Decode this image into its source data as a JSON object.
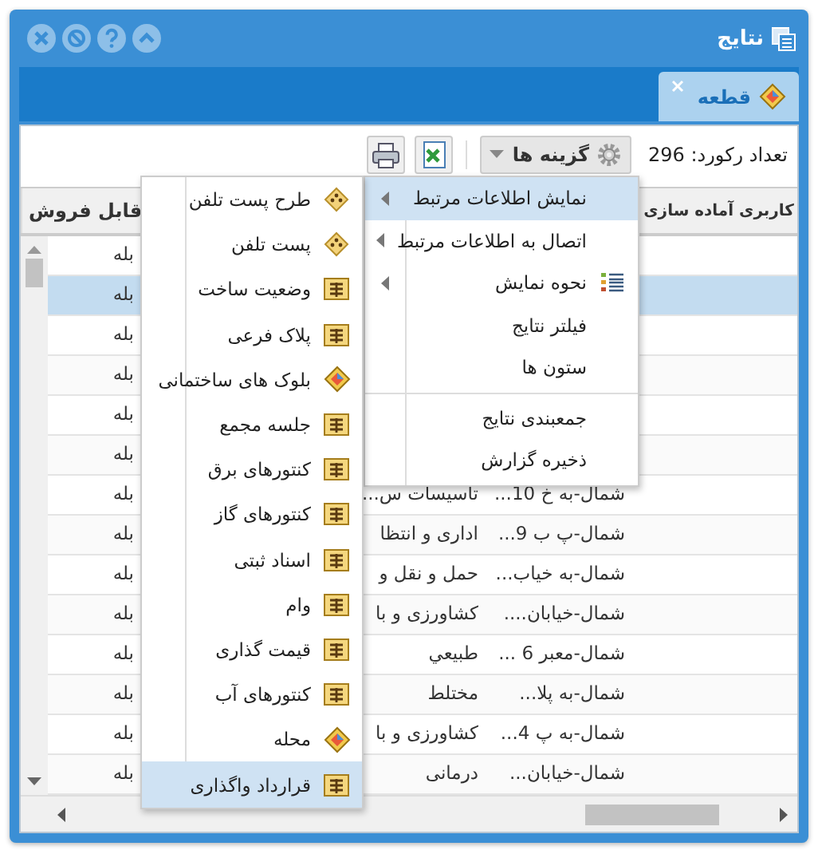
{
  "window": {
    "title": "نتایج"
  },
  "tabs": [
    {
      "label": "قطعه",
      "selected": true
    }
  ],
  "toolbar": {
    "record_count": "تعداد رکورد: 296",
    "options_button": "گزینه ها"
  },
  "table": {
    "columns": [
      "کاربری آماده سازی",
      "قابل فروش"
    ],
    "rows": [
      {
        "selected": false,
        "saleable": "بله"
      },
      {
        "selected": true,
        "saleable": "بله"
      },
      {
        "selected": false,
        "saleable": "بله"
      },
      {
        "selected": false,
        "saleable": "بله"
      },
      {
        "selected": false,
        "saleable": "بله"
      },
      {
        "selected": false,
        "saleable": "بله"
      },
      {
        "selected": false,
        "address": "شمال-به خ 10...",
        "usage": "تاسیسات س...",
        "saleable": "بله"
      },
      {
        "selected": false,
        "address": "شمال-پ ب 9...",
        "usage": "اداری و انتظا",
        "saleable": "بله"
      },
      {
        "selected": false,
        "address": "شمال-به خیاب...",
        "usage": "حمل و نقل و",
        "saleable": "بله"
      },
      {
        "selected": false,
        "address": "شمال-خیابان....",
        "usage": "کشاورزی و با",
        "saleable": "بله"
      },
      {
        "selected": false,
        "address": "شمال-معبر 6 ...",
        "usage": "طبیعي",
        "saleable": "بله"
      },
      {
        "selected": false,
        "address": "شمال-به پلا...",
        "usage": "مختلط",
        "saleable": "بله"
      },
      {
        "selected": false,
        "address": "شمال-به پ 4...",
        "usage": "کشاورزی و با",
        "saleable": "بله"
      },
      {
        "selected": false,
        "address": "شمال-خیابان...",
        "usage": "درمانی",
        "saleable": "بله"
      }
    ]
  },
  "options_menu": [
    {
      "kind": "plain",
      "label": "نمایش اطلاعات مرتبط",
      "selected": true,
      "submenu": true
    },
    {
      "kind": "plain",
      "label": "اتصال به اطلاعات مرتبط",
      "selected": false,
      "submenu": true
    },
    {
      "kind": "list",
      "label": "نحوه نمایش",
      "selected": false,
      "submenu": true
    },
    {
      "kind": "plain",
      "label": "فیلتر نتایج",
      "selected": false,
      "submenu": false
    },
    {
      "kind": "plain",
      "label": "ستون ها",
      "selected": false,
      "submenu": false
    },
    {
      "kind": "separator"
    },
    {
      "kind": "plain",
      "label": "جمعبندی نتایج",
      "selected": false,
      "submenu": false
    },
    {
      "kind": "plain",
      "label": "ذخیره گزارش",
      "selected": false,
      "submenu": false
    }
  ],
  "related_menu": [
    {
      "kind": "dots",
      "label": "طرح پست تلفن",
      "selected": false
    },
    {
      "kind": "dots",
      "label": "پست تلفن",
      "selected": false
    },
    {
      "kind": "table",
      "label": "وضعیت ساخت",
      "selected": false
    },
    {
      "kind": "table",
      "label": "پلاک فرعی",
      "selected": false
    },
    {
      "kind": "diamond",
      "label": "بلوک های ساختمانی",
      "selected": false
    },
    {
      "kind": "table",
      "label": "جلسه مجمع",
      "selected": false
    },
    {
      "kind": "table",
      "label": "کنتورهای برق",
      "selected": false
    },
    {
      "kind": "table",
      "label": "کنتورهای گاز",
      "selected": false
    },
    {
      "kind": "table",
      "label": "اسناد ثبتی",
      "selected": false
    },
    {
      "kind": "table",
      "label": "وام",
      "selected": false
    },
    {
      "kind": "table",
      "label": "قیمت گذاری",
      "selected": false
    },
    {
      "kind": "table",
      "label": "کنتورهای آب",
      "selected": false
    },
    {
      "kind": "diamond",
      "label": "محله",
      "selected": false
    },
    {
      "kind": "table",
      "label": "قرارداد واگذاری",
      "selected": true
    }
  ]
}
